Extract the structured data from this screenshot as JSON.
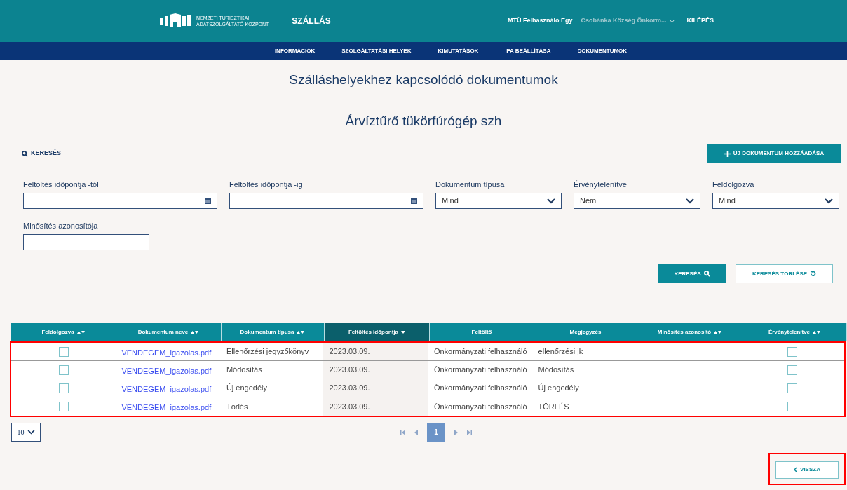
{
  "header": {
    "logo_line1": "NEMZETI TURISZTIKAI",
    "logo_line2": "ADATSZOLGÁLTATÓ KÖZPONT",
    "app": "SZÁLLÁS",
    "user": "MTÜ Felhasználó Egy",
    "organization": "Csobánka Község Önkorm...",
    "logout": "KILÉPÉS"
  },
  "nav": [
    {
      "label": "INFORMÁCIÓK",
      "selected": false
    },
    {
      "label": "SZOLGÁLTATÁSI HELYEK",
      "selected": false
    },
    {
      "label": "KIMUTATÁSOK",
      "selected": false
    },
    {
      "label": "IFA BEÁLLÍTÁSA",
      "selected": false
    },
    {
      "label": "DOKUMENTUMOK",
      "selected": false
    }
  ],
  "title": "Szálláshelyekhez kapcsolódó dokumentumok",
  "subtitle": "Árvíztűrő tükörfúrógép szh",
  "search_toggle": "KERESÉS",
  "add_button": "ÚJ DOKUMENTUM HOZZÁADÁSA",
  "filters": [
    {
      "label": "Feltöltés időpontja -tól",
      "kind": "date"
    },
    {
      "label": "Feltöltés időpontja -ig",
      "kind": "date"
    },
    {
      "label": "Dokumentum típusa",
      "kind": "select",
      "value": "Mind"
    },
    {
      "label": "Érvénytelenítve",
      "kind": "select",
      "value": "Nem"
    },
    {
      "label": "Feldolgozva",
      "kind": "select",
      "value": "Mind"
    },
    {
      "label": "Minősítés azonosítója",
      "kind": "text"
    }
  ],
  "search_button": "KERESÉS",
  "clear_button": "KERESÉS TÖRLÉSE",
  "table": {
    "columns": [
      {
        "label": "Feldolgozva",
        "sortable": true,
        "sorted": false
      },
      {
        "label": "Dokumentum neve",
        "sortable": true,
        "sorted": false
      },
      {
        "label": "Dokumentum típusa",
        "sortable": true,
        "sorted": false
      },
      {
        "label": "Feltöltés időpontja",
        "sortable": true,
        "sorted": true
      },
      {
        "label": "Feltöltő",
        "sortable": false,
        "sorted": false
      },
      {
        "label": "Megjegyzés",
        "sortable": false,
        "sorted": false
      },
      {
        "label": "Minősítés azonosító",
        "sortable": true,
        "sorted": false
      },
      {
        "label": "Érvénytelenítve",
        "sortable": true,
        "sorted": false
      }
    ],
    "rows": [
      {
        "processed": false,
        "name": "VENDEGEM_igazolas.pdf",
        "type": "Ellenőrzési jegyzőkönyv",
        "date": "2023.03.09.",
        "uploader": "Önkormányzati felhasználó",
        "note": "ellenőrzési jk",
        "invalidated": false
      },
      {
        "processed": false,
        "name": "VENDEGEM_igazolas.pdf",
        "type": "Módosítás",
        "date": "2023.03.09.",
        "uploader": "Önkormányzati felhasználó",
        "note": "Módosítás",
        "invalidated": false
      },
      {
        "processed": false,
        "name": "VENDEGEM_igazolas.pdf",
        "type": "Új engedély",
        "date": "2023.03.09.",
        "uploader": "Önkormányzati felhasználó",
        "note": "Új engedély",
        "invalidated": false
      },
      {
        "processed": false,
        "name": "VENDEGEM_igazolas.pdf",
        "type": "Törlés",
        "date": "2023.03.09.",
        "uploader": "Önkormányzati felhasználó",
        "note": "TÖRLÉS",
        "invalidated": false
      }
    ]
  },
  "page_size": "10",
  "pages": [
    {
      "label": "1",
      "selected": true
    }
  ],
  "back_button": "VISSZA"
}
